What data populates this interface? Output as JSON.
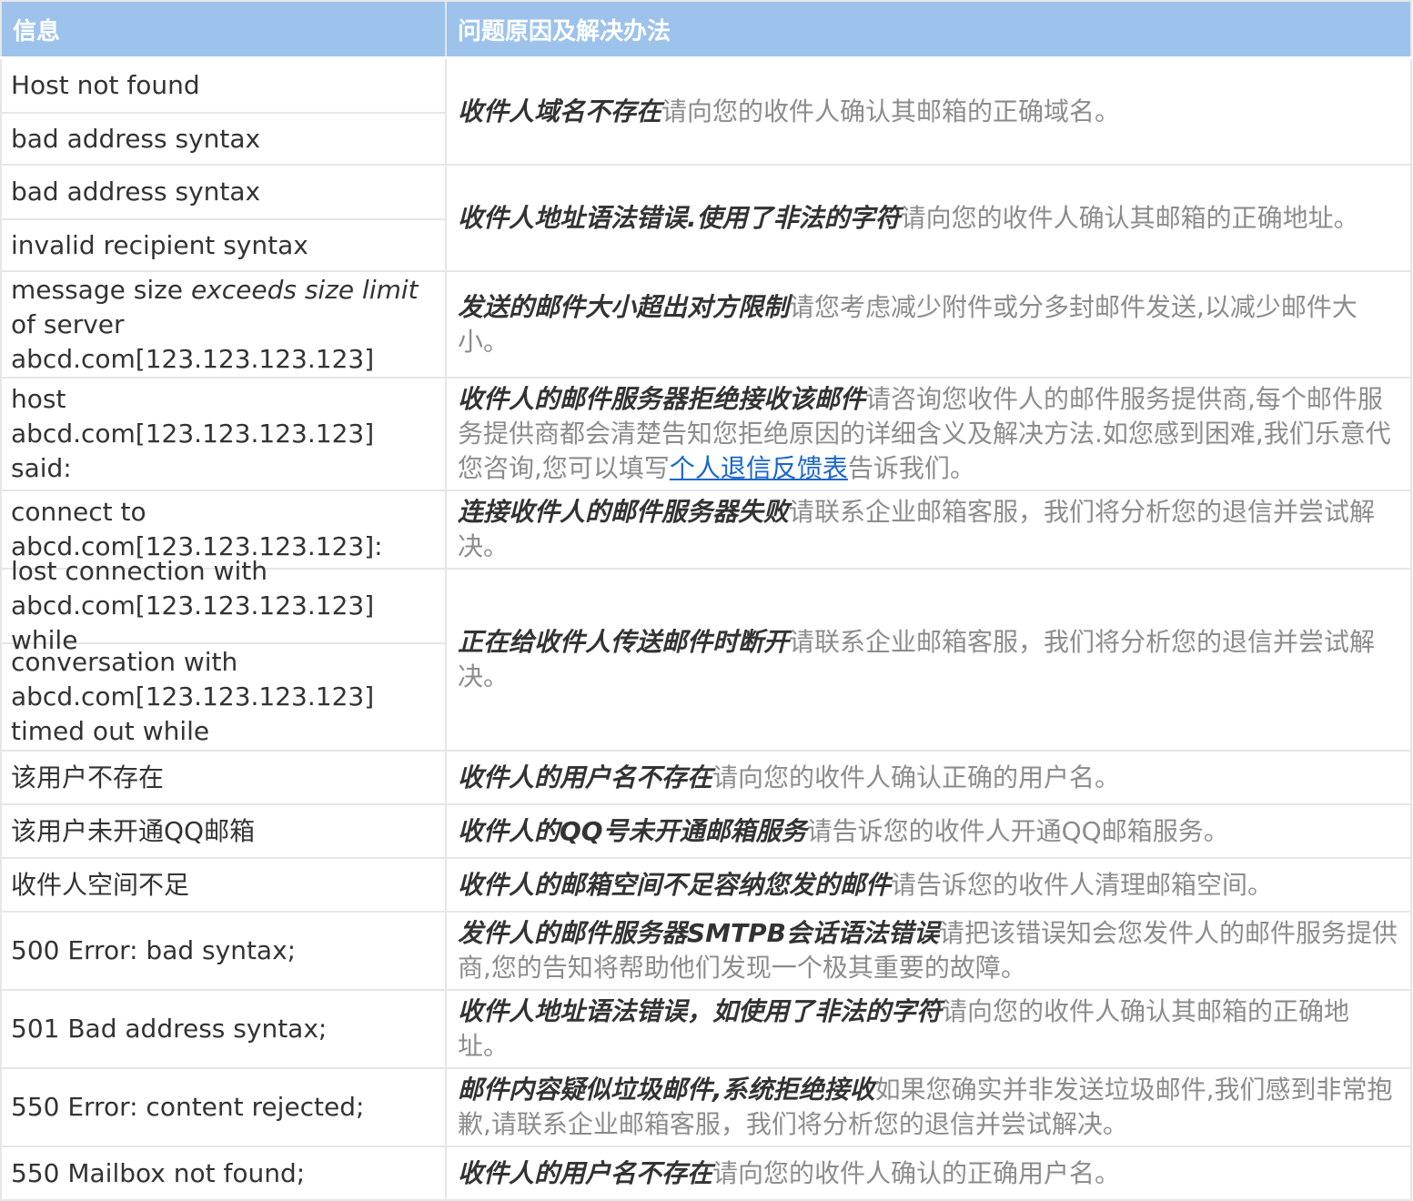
{
  "headers": {
    "info": "信息",
    "solution": "问题原因及解决办法"
  },
  "rows": [
    {
      "info": [
        "Host not found",
        "bad address syntax"
      ],
      "cause": "收件人域名不存在",
      "solution": "请向您的收件人确认其邮箱的正确域名。"
    },
    {
      "info": [
        "bad address syntax",
        "invalid recipient syntax"
      ],
      "cause": "收件人地址语法错误.使用了非法的字符",
      "solution": "请向您的收件人确认其邮箱的正确地址。"
    },
    {
      "info_plain": "message size ",
      "info_italic": "exceeds size limit",
      "info_rest": " of server abcd.com[123.123.123.123]",
      "cause": "发送的邮件大小超出对方限制",
      "solution": "请您考虑减少附件或分多封邮件发送,以减少邮件大小。"
    },
    {
      "info": [
        "host abcd.com[123.123.123.123] said:"
      ],
      "cause": "收件人的邮件服务器拒绝接收该邮件",
      "solution_before": "请咨询您收件人的邮件服务提供商,每个邮件服务提供商都会清楚告知您拒绝原因的详细含义及解决方法.如您感到困难,我们乐意代您咨询,您可以填写",
      "link": "个人退信反馈表",
      "solution_after": "告诉我们。"
    },
    {
      "info": [
        "connect to abcd.com[123.123.123.123]:"
      ],
      "cause": "连接收件人的邮件服务器失败",
      "solution": "请联系企业邮箱客服，我们将分析您的退信并尝试解决。"
    },
    {
      "info": [
        "lost connection with abcd.com[123.123.123.123] while",
        "conversation with abcd.com[123.123.123.123] timed out while"
      ],
      "cause": "正在给收件人传送邮件时断开",
      "solution": "请联系企业邮箱客服，我们将分析您的退信并尝试解决。"
    },
    {
      "info": [
        "该用户不存在"
      ],
      "cause": "收件人的用户名不存在",
      "solution": "请向您的收件人确认正确的用户名。"
    },
    {
      "info": [
        "该用户未开通QQ邮箱"
      ],
      "cause": "收件人的QQ号未开通邮箱服务",
      "solution": "请告诉您的收件人开通QQ邮箱服务。"
    },
    {
      "info": [
        "收件人空间不足"
      ],
      "cause": "收件人的邮箱空间不足容纳您发的邮件",
      "solution": "请告诉您的收件人清理邮箱空间。"
    },
    {
      "info": [
        "500 Error: bad syntax;"
      ],
      "cause": "发件人的邮件服务器SMTPB会话语法错误",
      "solution": "请把该错误知会您发件人的邮件服务提供商,您的告知将帮助他们发现一个极其重要的故障。"
    },
    {
      "info": [
        "501 Bad address syntax;"
      ],
      "cause": "收件人地址语法错误，如使用了非法的字符",
      "solution": "请向您的收件人确认其邮箱的正确地址。"
    },
    {
      "info": [
        "550 Error: content rejected;"
      ],
      "cause": "邮件内容疑似垃圾邮件,系统拒绝接收",
      "solution": "如果您确实并非发送垃圾邮件,我们感到非常抱歉,请联系企业邮箱客服，我们将分析您的退信并尝试解决。"
    },
    {
      "info": [
        "550 Mailbox not found;"
      ],
      "cause": "收件人的用户名不存在",
      "solution": "请向您的收件人确认的正确用户名。"
    }
  ]
}
